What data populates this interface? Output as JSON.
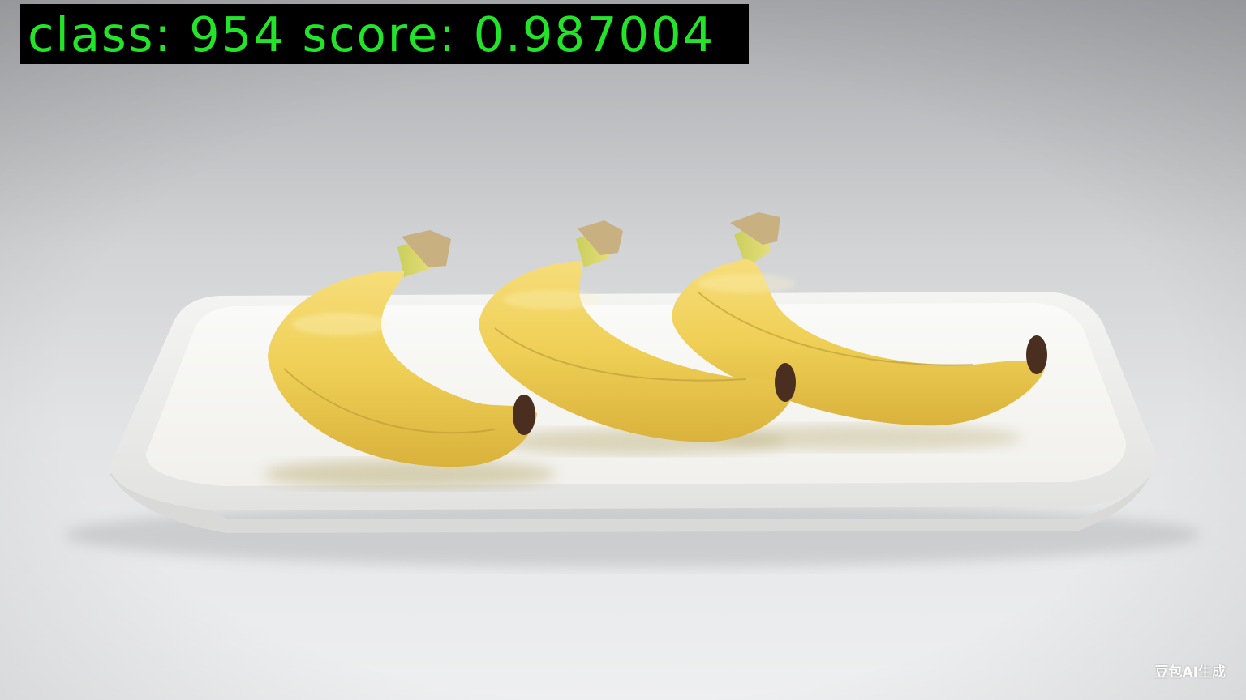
{
  "detection": {
    "label": "class: 954 score: 0.987004",
    "class_id": 954,
    "score": 0.987004,
    "text_color": "#22e52a",
    "box_color": "#000000"
  },
  "scene": {
    "subject": "three bananas on a white rectangular plate",
    "banana_color": "#f0d460",
    "plate_color": "#f7f6f2",
    "background_color": "#d9dadc"
  },
  "watermark": {
    "text": "豆包AI生成"
  }
}
